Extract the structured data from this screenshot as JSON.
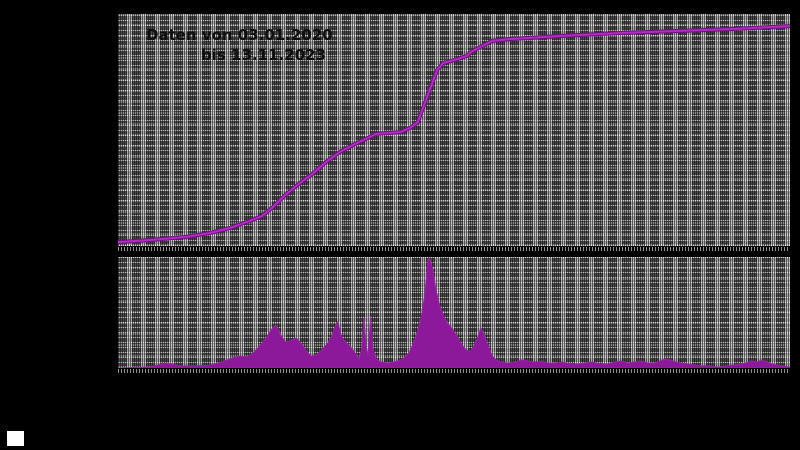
{
  "annotation": {
    "line1": "Daten von 03.01.2020",
    "line2": "bis 13.11.2023"
  },
  "colors": {
    "background": "#000000",
    "plot_base": "#7e7e7e",
    "line": "#b12cc0",
    "line_edge": "#6e1080",
    "fill": "#8c189a",
    "fill_edge": "#9c20aa",
    "annotation_text": "#0e0e0e",
    "legend_swatch": "#fefefe"
  },
  "chart_data": [
    {
      "id": "cumulative",
      "type": "line",
      "title": "",
      "x_start_label": "03.01.2020",
      "x_end_label": "13.11.2023",
      "note": "upper panel: cumulative curve; axis tick labels not visible (black on black), values normalized 0-1 of panel height",
      "points": [
        [
          0.0,
          0.017
        ],
        [
          0.048,
          0.026
        ],
        [
          0.1,
          0.039
        ],
        [
          0.137,
          0.056
        ],
        [
          0.167,
          0.078
        ],
        [
          0.196,
          0.108
        ],
        [
          0.214,
          0.129
        ],
        [
          0.229,
          0.164
        ],
        [
          0.249,
          0.22
        ],
        [
          0.271,
          0.272
        ],
        [
          0.289,
          0.31
        ],
        [
          0.308,
          0.358
        ],
        [
          0.33,
          0.405
        ],
        [
          0.353,
          0.44
        ],
        [
          0.372,
          0.466
        ],
        [
          0.384,
          0.483
        ],
        [
          0.42,
          0.491
        ],
        [
          0.435,
          0.509
        ],
        [
          0.446,
          0.534
        ],
        [
          0.461,
          0.651
        ],
        [
          0.475,
          0.759
        ],
        [
          0.484,
          0.789
        ],
        [
          0.501,
          0.802
        ],
        [
          0.519,
          0.819
        ],
        [
          0.525,
          0.836
        ],
        [
          0.542,
          0.862
        ],
        [
          0.557,
          0.884
        ],
        [
          0.583,
          0.892
        ],
        [
          0.658,
          0.905
        ],
        [
          0.747,
          0.918
        ],
        [
          0.836,
          0.927
        ],
        [
          0.911,
          0.935
        ],
        [
          1.0,
          0.948
        ]
      ]
    },
    {
      "id": "daily",
      "type": "area",
      "title": "",
      "x_start_label": "03.01.2020",
      "x_end_label": "13.11.2023",
      "note": "lower panel: daily values; axis tick labels not visible, values normalized 0-1 of panel height",
      "points": [
        [
          0.0,
          0.0
        ],
        [
          0.048,
          0.01
        ],
        [
          0.06,
          0.027
        ],
        [
          0.07,
          0.045
        ],
        [
          0.08,
          0.036
        ],
        [
          0.092,
          0.018
        ],
        [
          0.115,
          0.018
        ],
        [
          0.137,
          0.027
        ],
        [
          0.155,
          0.054
        ],
        [
          0.17,
          0.09
        ],
        [
          0.182,
          0.108
        ],
        [
          0.192,
          0.1
        ],
        [
          0.201,
          0.135
        ],
        [
          0.211,
          0.198
        ],
        [
          0.22,
          0.27
        ],
        [
          0.228,
          0.342
        ],
        [
          0.235,
          0.387
        ],
        [
          0.241,
          0.306
        ],
        [
          0.249,
          0.234
        ],
        [
          0.256,
          0.243
        ],
        [
          0.265,
          0.27
        ],
        [
          0.272,
          0.225
        ],
        [
          0.28,
          0.153
        ],
        [
          0.287,
          0.108
        ],
        [
          0.295,
          0.117
        ],
        [
          0.302,
          0.153
        ],
        [
          0.311,
          0.216
        ],
        [
          0.318,
          0.279
        ],
        [
          0.323,
          0.369
        ],
        [
          0.327,
          0.414
        ],
        [
          0.332,
          0.297
        ],
        [
          0.338,
          0.234
        ],
        [
          0.345,
          0.198
        ],
        [
          0.353,
          0.135
        ],
        [
          0.359,
          0.081
        ],
        [
          0.363,
          0.18
        ],
        [
          0.366,
          0.45
        ],
        [
          0.369,
          0.198
        ],
        [
          0.372,
          0.108
        ],
        [
          0.376,
          0.468
        ],
        [
          0.379,
          0.18
        ],
        [
          0.384,
          0.081
        ],
        [
          0.391,
          0.054
        ],
        [
          0.402,
          0.045
        ],
        [
          0.412,
          0.054
        ],
        [
          0.424,
          0.081
        ],
        [
          0.434,
          0.144
        ],
        [
          0.443,
          0.27
        ],
        [
          0.451,
          0.45
        ],
        [
          0.457,
          0.676
        ],
        [
          0.461,
          0.973
        ],
        [
          0.464,
          0.991
        ],
        [
          0.469,
          0.865
        ],
        [
          0.473,
          0.703
        ],
        [
          0.479,
          0.559
        ],
        [
          0.485,
          0.468
        ],
        [
          0.491,
          0.396
        ],
        [
          0.499,
          0.342
        ],
        [
          0.506,
          0.27
        ],
        [
          0.512,
          0.207
        ],
        [
          0.518,
          0.162
        ],
        [
          0.524,
          0.144
        ],
        [
          0.53,
          0.198
        ],
        [
          0.536,
          0.288
        ],
        [
          0.54,
          0.36
        ],
        [
          0.545,
          0.297
        ],
        [
          0.551,
          0.198
        ],
        [
          0.557,
          0.108
        ],
        [
          0.563,
          0.072
        ],
        [
          0.57,
          0.054
        ],
        [
          0.58,
          0.045
        ],
        [
          0.591,
          0.054
        ],
        [
          0.601,
          0.072
        ],
        [
          0.61,
          0.063
        ],
        [
          0.62,
          0.054
        ],
        [
          0.631,
          0.063
        ],
        [
          0.64,
          0.045
        ],
        [
          0.65,
          0.045
        ],
        [
          0.661,
          0.054
        ],
        [
          0.673,
          0.036
        ],
        [
          0.685,
          0.036
        ],
        [
          0.695,
          0.045
        ],
        [
          0.705,
          0.054
        ],
        [
          0.717,
          0.036
        ],
        [
          0.729,
          0.036
        ],
        [
          0.74,
          0.054
        ],
        [
          0.749,
          0.063
        ],
        [
          0.759,
          0.045
        ],
        [
          0.769,
          0.054
        ],
        [
          0.778,
          0.063
        ],
        [
          0.789,
          0.045
        ],
        [
          0.798,
          0.045
        ],
        [
          0.807,
          0.063
        ],
        [
          0.814,
          0.081
        ],
        [
          0.821,
          0.072
        ],
        [
          0.83,
          0.054
        ],
        [
          0.839,
          0.045
        ],
        [
          0.848,
          0.036
        ],
        [
          0.859,
          0.027
        ],
        [
          0.869,
          0.018
        ],
        [
          0.881,
          0.018
        ],
        [
          0.893,
          0.009
        ],
        [
          0.905,
          0.018
        ],
        [
          0.915,
          0.027
        ],
        [
          0.926,
          0.036
        ],
        [
          0.934,
          0.045
        ],
        [
          0.943,
          0.063
        ],
        [
          0.951,
          0.054
        ],
        [
          0.958,
          0.072
        ],
        [
          0.966,
          0.054
        ],
        [
          0.973,
          0.036
        ],
        [
          0.981,
          0.027
        ],
        [
          0.988,
          0.018
        ],
        [
          1.0,
          0.009
        ]
      ]
    }
  ]
}
